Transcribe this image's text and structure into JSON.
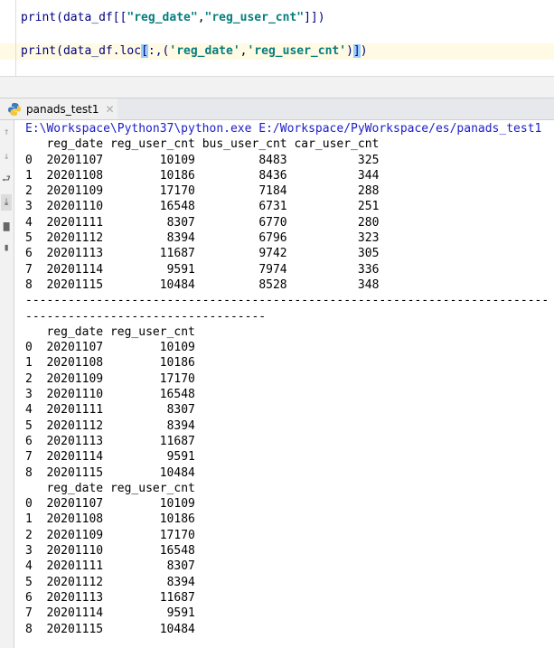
{
  "editor": {
    "line1": {
      "fn": "print(data_df[[",
      "s1": "\"reg_date\"",
      "comma": ",",
      "s2": "\"reg_user_cnt\"",
      "end": "]])"
    },
    "line2": {
      "fn": "print(data_df.loc",
      "open": "[",
      "mid": ":,(",
      "s1": "'reg_date'",
      "comma": ",",
      "s2": "'reg_user_cnt'",
      "paren": ")",
      "close": "]",
      "end": ")"
    }
  },
  "run_tab": {
    "label": "panads_test1",
    "icon": "python-icon",
    "close_icon": "close-icon"
  },
  "console": {
    "toolbar_icons": [
      "arrow-up-icon",
      "arrow-down-icon",
      "soft-wrap-icon",
      "scroll-to-end-icon",
      "print-icon",
      "trash-icon"
    ],
    "command": "E:\\Workspace\\Python37\\python.exe E:/Workspace/PyWorkspace/es/panads_test1",
    "separator": "------------------------------------------------------------------------------------------------------------",
    "tables": [
      {
        "columns": [
          "reg_date",
          "reg_user_cnt",
          "bus_user_cnt",
          "car_user_cnt"
        ],
        "rows": [
          [
            "0",
            "20201107",
            "10109",
            "8483",
            "325"
          ],
          [
            "1",
            "20201108",
            "10186",
            "8436",
            "344"
          ],
          [
            "2",
            "20201109",
            "17170",
            "7184",
            "288"
          ],
          [
            "3",
            "20201110",
            "16548",
            "6731",
            "251"
          ],
          [
            "4",
            "20201111",
            "8307",
            "6770",
            "280"
          ],
          [
            "5",
            "20201112",
            "8394",
            "6796",
            "323"
          ],
          [
            "6",
            "20201113",
            "11687",
            "9742",
            "305"
          ],
          [
            "7",
            "20201114",
            "9591",
            "7974",
            "336"
          ],
          [
            "8",
            "20201115",
            "10484",
            "8528",
            "348"
          ]
        ]
      },
      {
        "columns": [
          "reg_date",
          "reg_user_cnt"
        ],
        "rows": [
          [
            "0",
            "20201107",
            "10109"
          ],
          [
            "1",
            "20201108",
            "10186"
          ],
          [
            "2",
            "20201109",
            "17170"
          ],
          [
            "3",
            "20201110",
            "16548"
          ],
          [
            "4",
            "20201111",
            "8307"
          ],
          [
            "5",
            "20201112",
            "8394"
          ],
          [
            "6",
            "20201113",
            "11687"
          ],
          [
            "7",
            "20201114",
            "9591"
          ],
          [
            "8",
            "20201115",
            "10484"
          ]
        ]
      },
      {
        "columns": [
          "reg_date",
          "reg_user_cnt"
        ],
        "rows": [
          [
            "0",
            "20201107",
            "10109"
          ],
          [
            "1",
            "20201108",
            "10186"
          ],
          [
            "2",
            "20201109",
            "17170"
          ],
          [
            "3",
            "20201110",
            "16548"
          ],
          [
            "4",
            "20201111",
            "8307"
          ],
          [
            "5",
            "20201112",
            "8394"
          ],
          [
            "6",
            "20201113",
            "11687"
          ],
          [
            "7",
            "20201114",
            "9591"
          ],
          [
            "8",
            "20201115",
            "10484"
          ]
        ]
      }
    ]
  }
}
